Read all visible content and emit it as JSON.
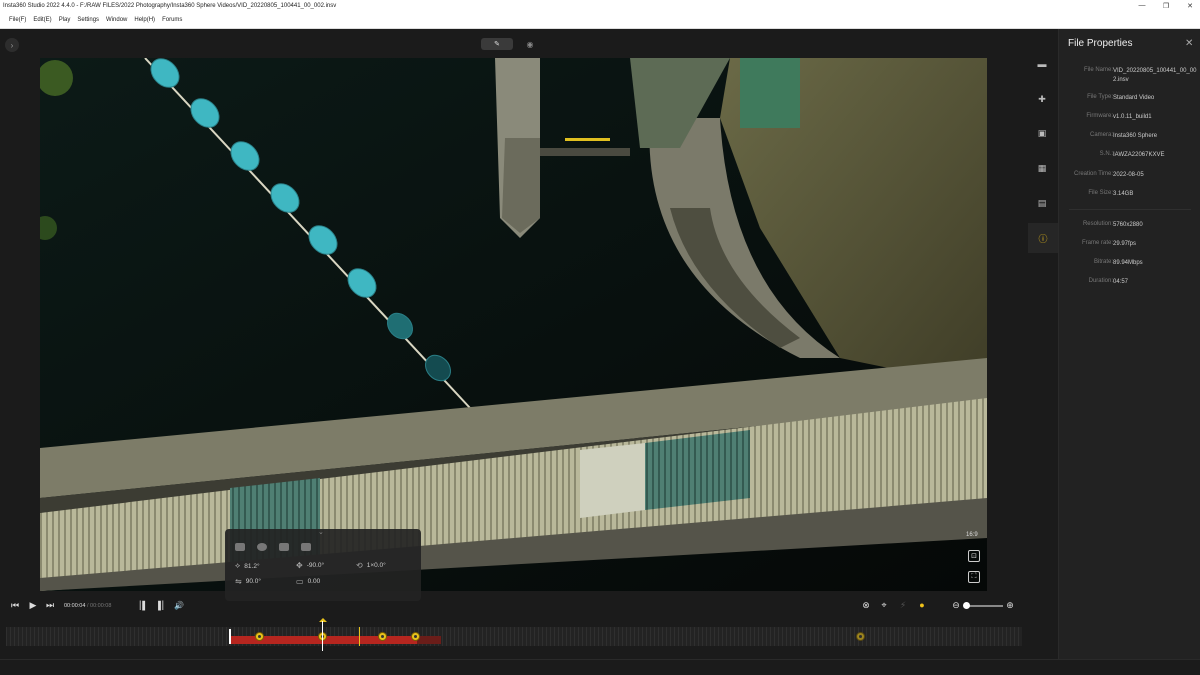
{
  "window": {
    "title": "Insta360 Studio 2022 4.4.0 - F:/RAW FILES/2022 Photography/Insta360 Sphere Videos/VID_20220805_100441_00_002.insv",
    "minimize": "—",
    "maximize": "❐",
    "close": "✕"
  },
  "menu": [
    "File(F)",
    "Edit(E)",
    "Play",
    "Settings",
    "Window",
    "Help(H)",
    "Forums"
  ],
  "preview": {
    "aspect_ratio": "16:9",
    "params": {
      "fov": "81.2°",
      "pitch": "-90.0°",
      "roll": "1×0.0°",
      "yaw": "90.0°",
      "distortion": "0.00"
    }
  },
  "playback": {
    "current_time": "00:00:04",
    "total_time": "/ 00:00:08"
  },
  "file_properties": {
    "title": "File Properties",
    "rows": [
      {
        "label": "File Name:",
        "value": "VID_20220805_100441_00_002.insv"
      },
      {
        "label": "File Type:",
        "value": "Standard Video"
      },
      {
        "label": "Firmware:",
        "value": "v1.0.11_build1"
      },
      {
        "label": "Camera:",
        "value": "Insta360 Sphere"
      },
      {
        "label": "S.N.:",
        "value": "IAWZA22067KXVE"
      },
      {
        "label": "Creation Time:",
        "value": "2022-08-05"
      },
      {
        "label": "File Size:",
        "value": "3.14GB"
      },
      {
        "label": "Resolution:",
        "value": "5760x2880"
      },
      {
        "label": "Frame rate:",
        "value": "29.97fps"
      },
      {
        "label": "Bitrate:",
        "value": "89.94Mbps"
      },
      {
        "label": "Duration:",
        "value": "04:57"
      }
    ]
  },
  "colors": {
    "accent": "#f0c21a",
    "clip": "#b6261f"
  },
  "icons": {
    "play": "▶",
    "prev": "⏮",
    "next": "⏭",
    "volume": "🔊",
    "export": "⇪"
  }
}
